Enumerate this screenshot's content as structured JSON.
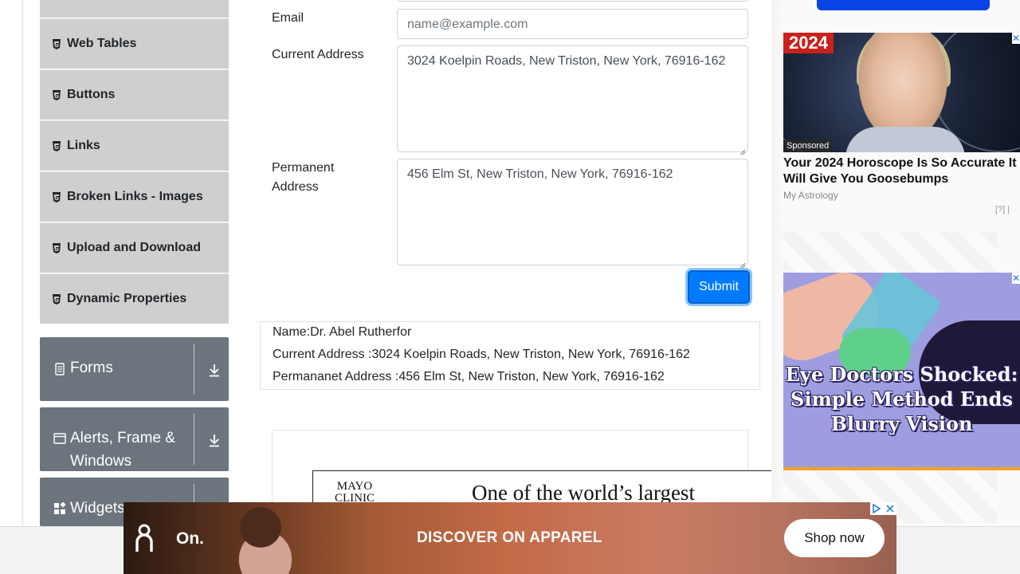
{
  "sidebar": {
    "subitems": [
      {
        "label": "Web Tables"
      },
      {
        "label": "Buttons"
      },
      {
        "label": "Links"
      },
      {
        "label": "Broken Links - Images"
      },
      {
        "label": "Upload and Download"
      },
      {
        "label": "Dynamic Properties"
      }
    ],
    "groups": [
      {
        "label": "Forms",
        "icon": "form-icon"
      },
      {
        "label": "Alerts, Frame &",
        "label2": "Windows",
        "icon": "window-icon"
      },
      {
        "label": "Widgets",
        "icon": "widgets-icon"
      }
    ]
  },
  "form": {
    "email_label": "Email",
    "email_placeholder": "name@example.com",
    "current_address_label": "Current Address",
    "current_address_value": "3024 Koelpin Roads, New Triston, New York, 76916-162",
    "permanent_address_label_line1": "Permanent",
    "permanent_address_label_line2": "Address",
    "permanent_address_value": "456 Elm St, New Triston, New York, 76916-162",
    "submit_label": "Submit"
  },
  "output": {
    "name": "Name:Dr. Abel Rutherfor",
    "current_address": "Current Address :3024 Koelpin Roads, New Triston, New York, 76916-162",
    "permanent_address": "Permananet Address :456 Elm St, New Triston, New York, 76916-162"
  },
  "ads": {
    "mayo_logo_line1": "MAYO",
    "mayo_logo_line2": "CLINIC",
    "mayo_headline": "One of the world’s largest",
    "horoscope_badge": "2024",
    "horoscope_sponsored": "Sponsored",
    "horoscope_title": "Your 2024 Horoscope Is So Accurate It Will Give You Goosebumps",
    "horoscope_source": "My Astrology",
    "horoscope_meta": "[?] |",
    "close_glyph": "✕",
    "eye_text": "Eye Doctors Shocked: Simple Method Ends Blurry Vision",
    "banner_brand": "On.",
    "banner_text": "DISCOVER ON APPAREL",
    "banner_cta": "Shop now"
  },
  "colors": {
    "accent": "#007bff",
    "group_bg": "#6c757d",
    "subitem_bg": "#cfcfcf"
  }
}
